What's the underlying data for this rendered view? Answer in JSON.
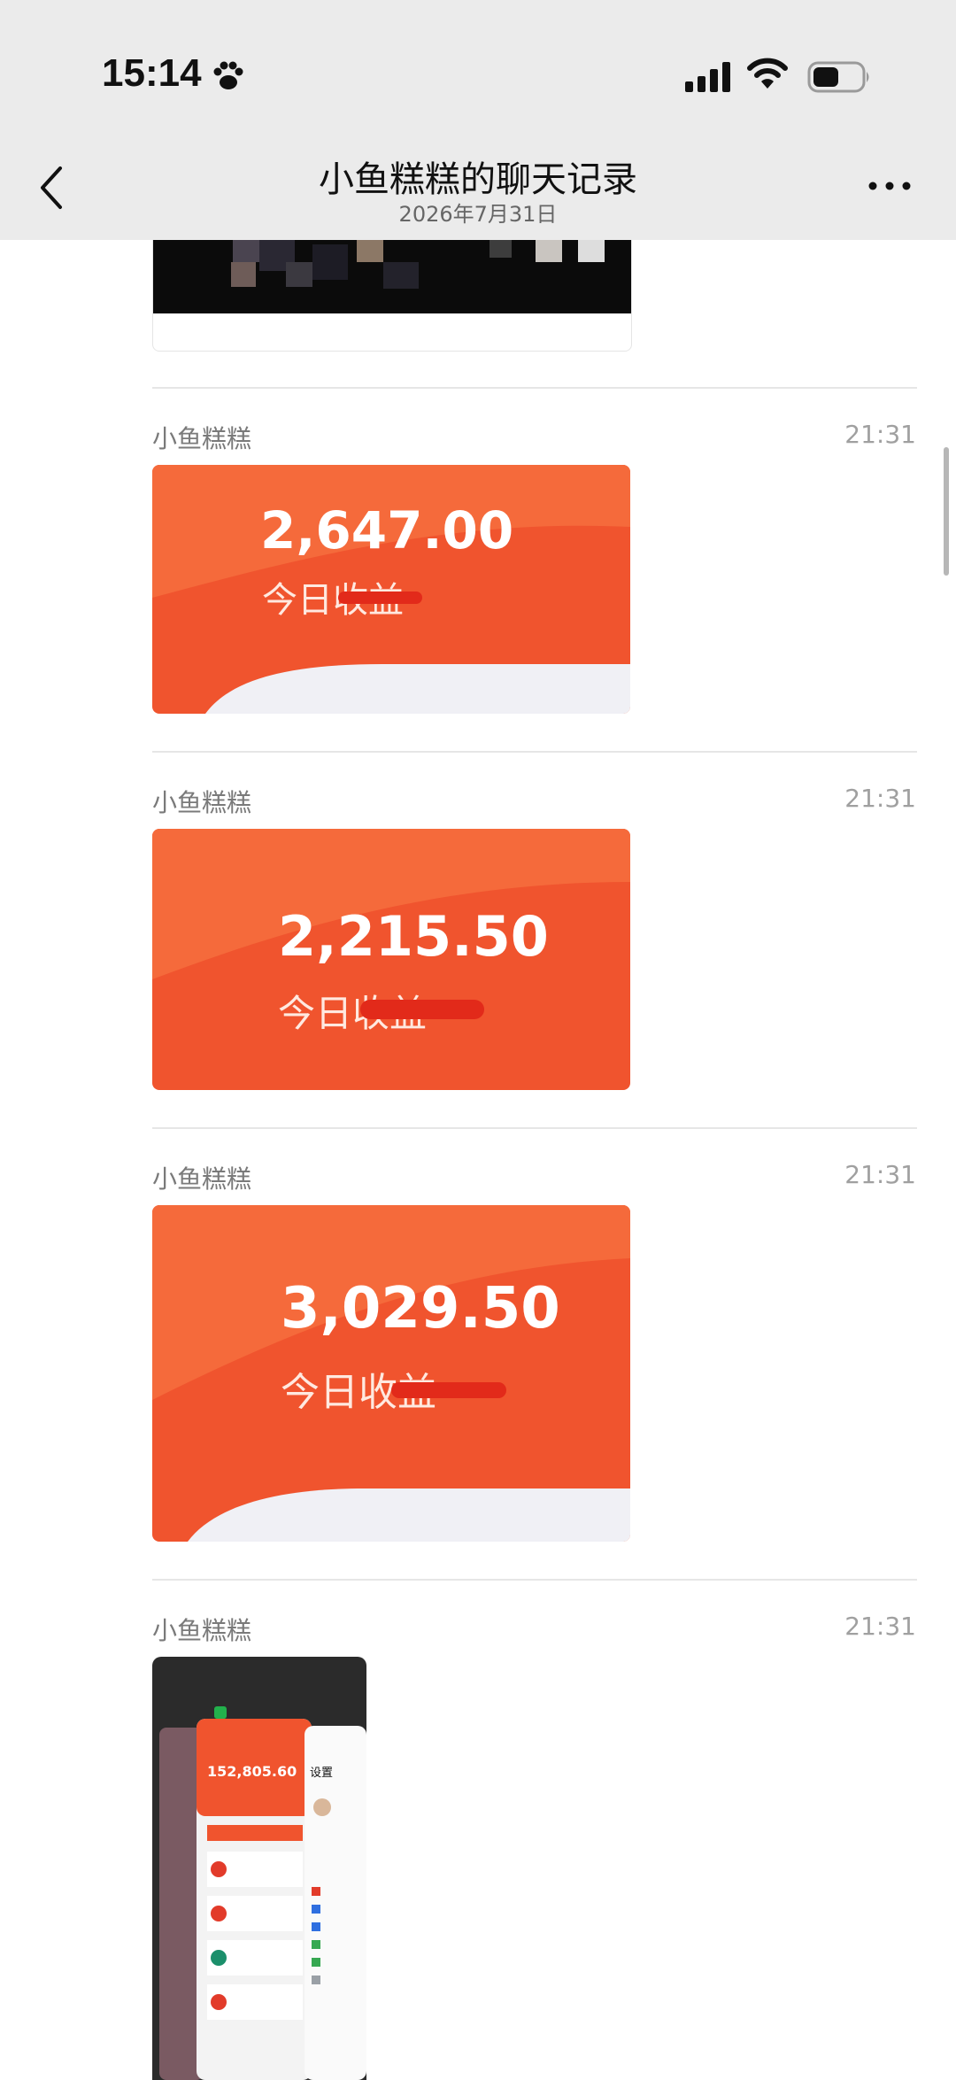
{
  "status_bar": {
    "time": "15:14"
  },
  "header": {
    "title": "小鱼糕糕的聊天记录",
    "date": "2026年7月31日"
  },
  "messages": [
    {
      "sender": "小鱼糕糕",
      "time": "21:31",
      "amount": "2,647.00",
      "label": "今日收益"
    },
    {
      "sender": "小鱼糕糕",
      "time": "21:31",
      "amount": "2,215.50",
      "label": "今日收益"
    },
    {
      "sender": "小鱼糕糕",
      "time": "21:31",
      "amount": "3,029.50",
      "label": "今日收益"
    },
    {
      "sender": "小鱼糕糕",
      "time": "21:31",
      "screenshot_amount": "152,805.60",
      "screenshot_settings": "设置"
    }
  ],
  "colors": {
    "header_bg": "#ebebeb",
    "card_orange": "#f0542e"
  }
}
